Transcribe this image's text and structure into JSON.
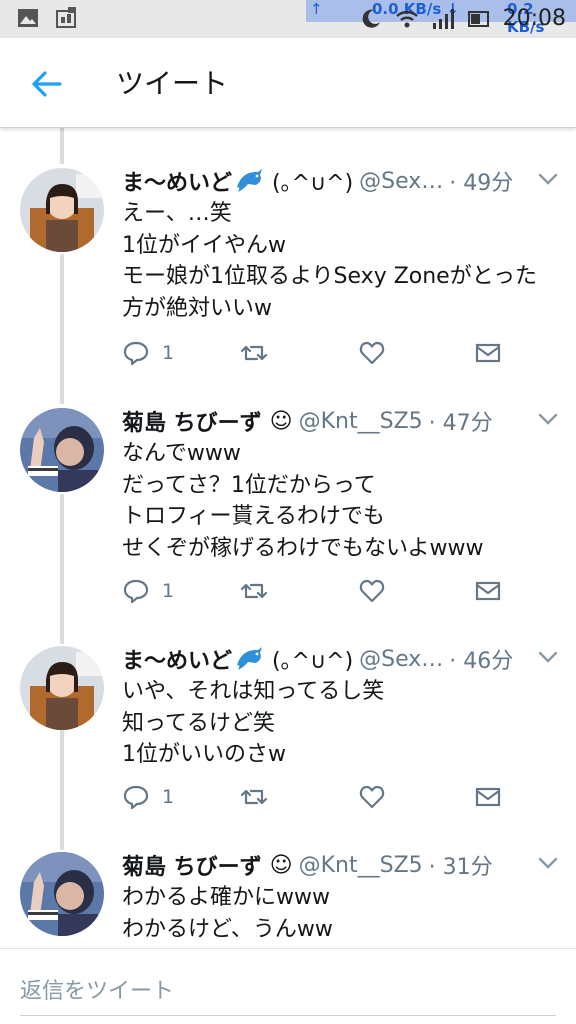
{
  "status_bar": {
    "net_up_arrow": "↑",
    "net_speed_a": "0.0 KB/s ↓",
    "net_speed_b": "0.2 KB/s",
    "time": "20:08"
  },
  "header": {
    "title": "ツイート",
    "back_icon": "arrow-left-icon"
  },
  "tweets": [
    {
      "name": "ま〜めいど",
      "handle_prefix": "(｡^∪^)",
      "handle": "@Sex…",
      "time": "· 49分",
      "lines": [
        "えー、…笑",
        "1位がイイやんw",
        "モー娘が1位取るよりSexy Zoneがとった",
        "方が絶対いいw"
      ],
      "reply_count": "1"
    },
    {
      "name": "菊島 ちびーず",
      "handle_prefix": "☺",
      "handle": "@Knt__SZ5",
      "time": "· 47分",
      "lines": [
        "なんでwww",
        "だってさ？1位だからって",
        "トロフィー貰えるわけでも",
        "せくぞが稼げるわけでもないよwww"
      ],
      "reply_count": "1"
    },
    {
      "name": "ま〜めいど",
      "handle_prefix": "(｡^∪^)",
      "handle": "@Sex…",
      "time": "· 46分",
      "lines": [
        "いや、それは知ってるし笑",
        "知ってるけど笑",
        "1位がいいのさw"
      ],
      "reply_count": "1"
    },
    {
      "name": "菊島 ちびーず",
      "handle_prefix": "☺",
      "handle": "@Knt__SZ5",
      "time": "· 31分",
      "lines": [
        "わかるよ確かにwww",
        "わかるけど、うんww"
      ]
    }
  ],
  "reply_bar": {
    "placeholder": "返信をツイート"
  },
  "colors": {
    "accent": "#1da1f2",
    "muted": "#657786",
    "thread_line": "#d8dde1"
  }
}
